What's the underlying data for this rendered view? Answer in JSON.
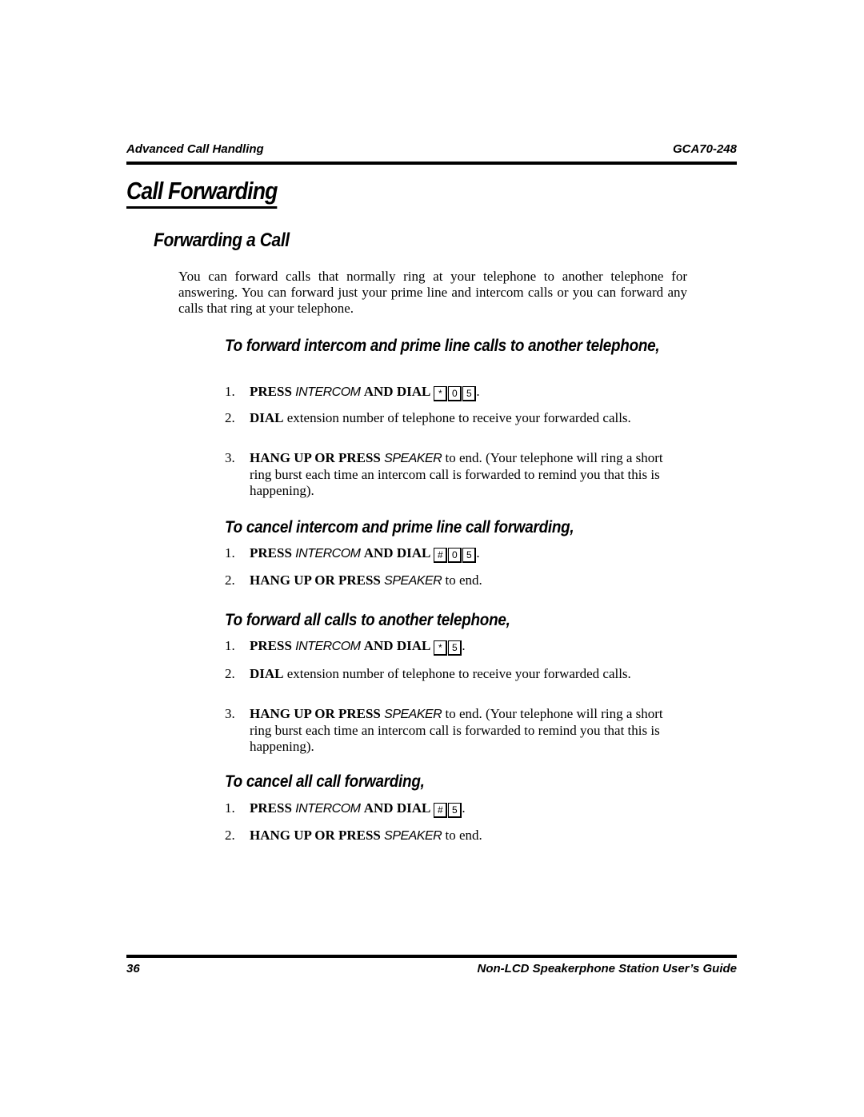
{
  "header": {
    "left": "Advanced Call Handling",
    "right": "GCA70-248"
  },
  "chapter_title": "Call Forwarding",
  "section_title": "Forwarding a Call",
  "intro": "You can forward calls that normally ring at your telephone to another telephone for answering. You can forward just your prime line and intercom calls or you can forward any calls that ring at your telephone.",
  "procedures": [
    {
      "heading": "To forward intercom and prime line calls to another telephone,",
      "steps": [
        {
          "num": "1.",
          "bold": "PRESS",
          "ital": "INTERCOM",
          "bold2": "AND DIAL",
          "keys": [
            "*",
            "0",
            "5"
          ],
          "tail": "."
        },
        {
          "num": "2.",
          "bold": "DIAL",
          "text": " extension number of telephone to receive your forwarded calls."
        },
        {
          "num": "3.",
          "bold": "HANG UP OR PRESS",
          "ital": "SPEAKER",
          "text": " to end. (Your telephone will ring a short ring burst each time an intercom call is forwarded to remind you that this is happening)."
        }
      ]
    },
    {
      "heading": "To cancel intercom and prime line call forwarding,",
      "steps": [
        {
          "num": "1.",
          "bold": "PRESS",
          "ital": "INTERCOM",
          "bold2": "AND DIAL",
          "keys": [
            "#",
            "0",
            "5"
          ],
          "tail": "."
        },
        {
          "num": "2.",
          "bold": "HANG UP OR PRESS",
          "ital": "SPEAKER",
          "text": " to end."
        }
      ]
    },
    {
      "heading": "To forward all calls to another telephone,",
      "steps": [
        {
          "num": "1.",
          "bold": "PRESS",
          "ital": "INTERCOM",
          "bold2": "AND DIAL",
          "keys": [
            "*",
            "5"
          ],
          "tail": "."
        },
        {
          "num": "2.",
          "bold": "DIAL",
          "text": " extension number of telephone to receive your forwarded calls."
        },
        {
          "num": "3.",
          "bold": "HANG UP OR PRESS",
          "ital": "SPEAKER",
          "text": " to end. (Your telephone will ring a short ring burst each time an intercom call is forwarded to remind you that this is happening)."
        }
      ]
    },
    {
      "heading": "To cancel all call forwarding,",
      "steps": [
        {
          "num": "1.",
          "bold": "PRESS",
          "ital": "INTERCOM",
          "bold2": "AND DIAL",
          "keys": [
            "#",
            "5"
          ],
          "tail": "."
        },
        {
          "num": "2.",
          "bold": "HANG UP OR PRESS",
          "ital": "SPEAKER",
          "text": " to end."
        }
      ]
    }
  ],
  "footer": {
    "page_number": "36",
    "title": "Non-LCD Speakerphone Station User’s Guide"
  }
}
